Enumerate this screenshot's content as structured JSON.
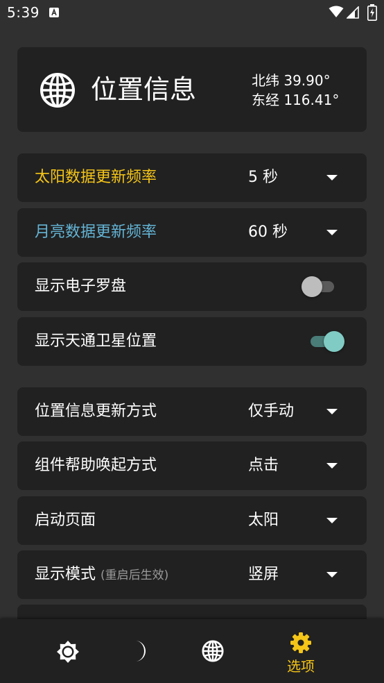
{
  "status_bar": {
    "time": "5:39"
  },
  "location": {
    "title": "位置信息",
    "latitude": "北纬 39.90°",
    "longitude": "东经 116.41°"
  },
  "colors": {
    "sun_label": "#f5c518",
    "moon_label": "#64b5d6",
    "accent": "#80cbc4",
    "nav_selected": "#f5c518"
  },
  "settings": {
    "sun_update": {
      "label": "太阳数据更新频率",
      "value": "5 秒"
    },
    "moon_update": {
      "label": "月亮数据更新频率",
      "value": "60 秒"
    },
    "show_compass": {
      "label": "显示电子罗盘",
      "checked": false
    },
    "show_tiantong": {
      "label": "显示天通卫星位置",
      "checked": true
    },
    "location_update_mode": {
      "label": "位置信息更新方式",
      "value": "仅手动"
    },
    "widget_wakeup": {
      "label": "组件帮助唤起方式",
      "value": "点击"
    },
    "startup_page": {
      "label": "启动页面",
      "value": "太阳"
    },
    "display_mode": {
      "label": "显示模式",
      "note": "(重启后生效)",
      "value": "竖屏"
    }
  },
  "bottom_nav": {
    "items": [
      {
        "icon": "sun-icon"
      },
      {
        "icon": "moon-icon"
      },
      {
        "icon": "globe-icon"
      },
      {
        "icon": "gear-icon",
        "label": "选项",
        "selected": true
      }
    ]
  }
}
